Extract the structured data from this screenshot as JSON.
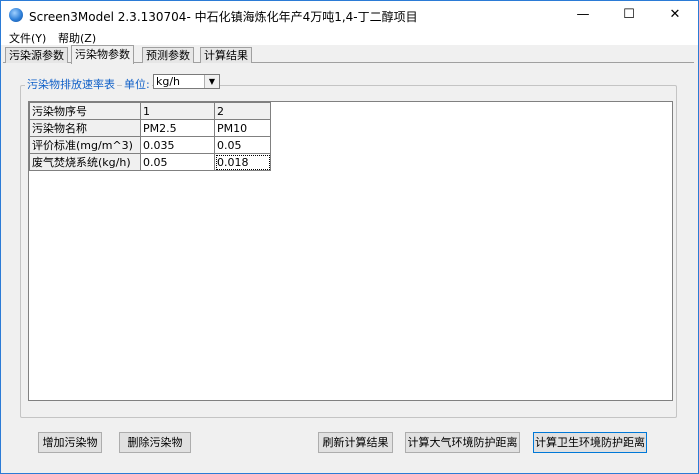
{
  "window": {
    "title": "Screen3Model 2.3.130704- 中石化镇海炼化年产4万吨1,4-丁二醇项目",
    "minimize": "—",
    "maximize": "☐",
    "close": "✕"
  },
  "menu": [
    {
      "label": "文件(Y)"
    },
    {
      "label": "帮助(Z)"
    }
  ],
  "tabs": [
    {
      "label": "污染源参数"
    },
    {
      "label": "污染物参数",
      "active": true
    },
    {
      "label": "预测参数"
    },
    {
      "label": "计算结果"
    }
  ],
  "group": {
    "title": "污染物排放速率表",
    "unit_label": "单位:",
    "unit_value": "kg/h"
  },
  "table": {
    "rows": [
      {
        "label": "污染物序号",
        "cells": [
          "1",
          "2"
        ]
      },
      {
        "label": "污染物名称",
        "cells": [
          "PM2.5",
          "PM10"
        ]
      },
      {
        "label": "评价标准(mg/m^3)",
        "cells": [
          "0.035",
          "0.05"
        ]
      },
      {
        "label": "废气焚烧系统(kg/h)",
        "cells": [
          "0.05",
          "0.018"
        ]
      }
    ]
  },
  "buttons": {
    "add": "增加污染物",
    "delete": "删除污染物",
    "refresh": "刷新计算结果",
    "atmo_distance": "计算大气环境防护距离",
    "health_distance": "计算卫生环境防护距离"
  }
}
